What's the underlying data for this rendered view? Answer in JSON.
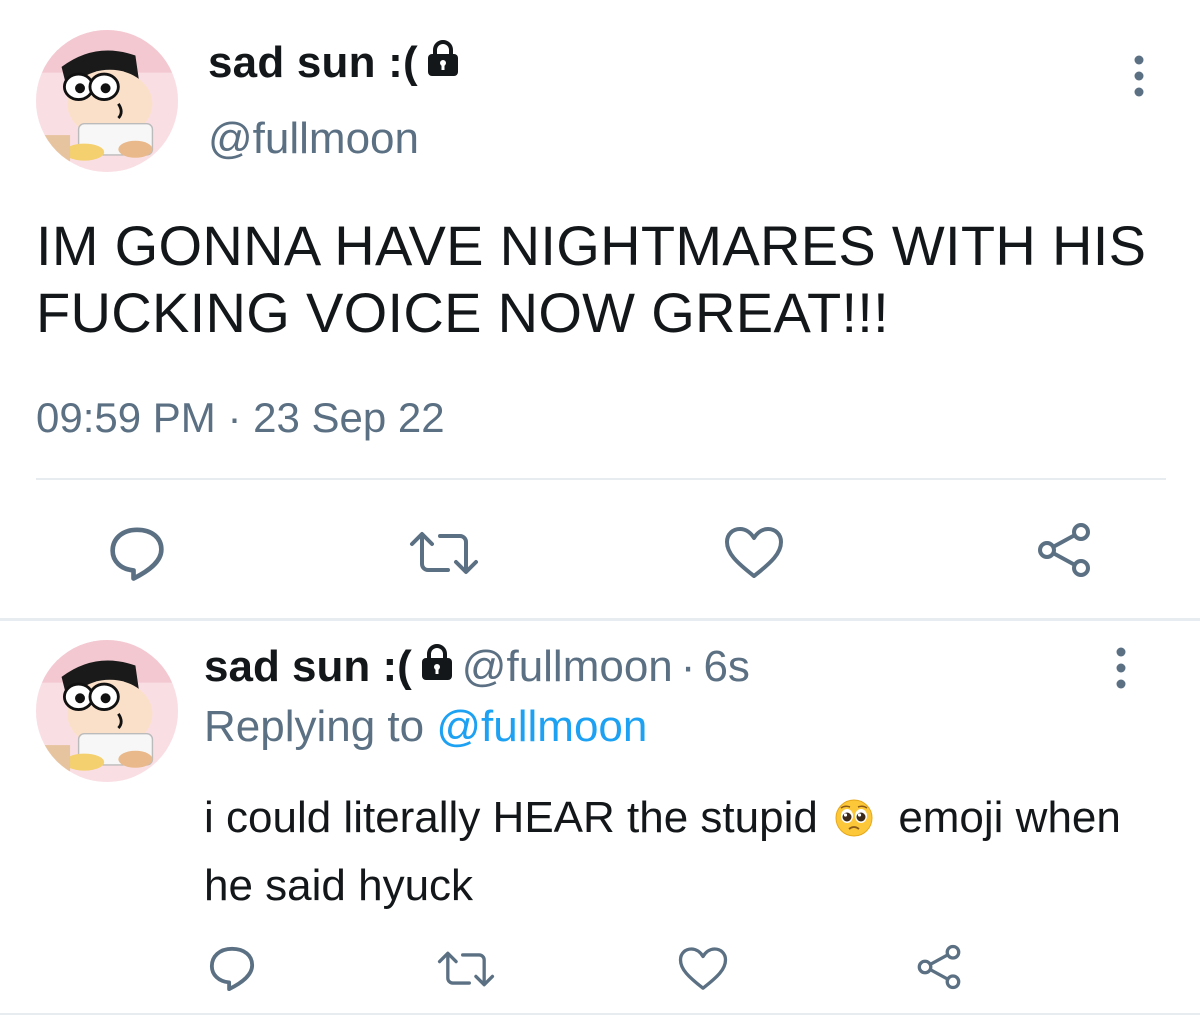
{
  "main_tweet": {
    "display_name": "sad sun :(",
    "handle": "@fullmoon",
    "text": "IM GONNA HAVE NIGHTMARES WITH HIS FUCKING VOICE NOW GREAT!!!",
    "timestamp": "09:59 PM · 23 Sep 22",
    "actions": [
      "reply-icon",
      "retweet-icon",
      "like-icon",
      "share-icon"
    ]
  },
  "reply_tweet": {
    "display_name": "sad sun :(",
    "handle": "@fullmoon",
    "separator": "·",
    "age": "6s",
    "replying_prefix": "Replying to",
    "replying_to": "@fullmoon",
    "text_before_emoji": "i could literally HEAR the stupid",
    "emoji": "pleading-face-emoji",
    "text_after_emoji": "emoji when he said hyuck",
    "actions": [
      "reply-icon",
      "retweet-icon",
      "like-icon",
      "share-icon"
    ]
  },
  "colors": {
    "text": "#14171a",
    "secondary": "#5b7083",
    "link": "#1da1f2",
    "divider": "#e6ecf0"
  }
}
